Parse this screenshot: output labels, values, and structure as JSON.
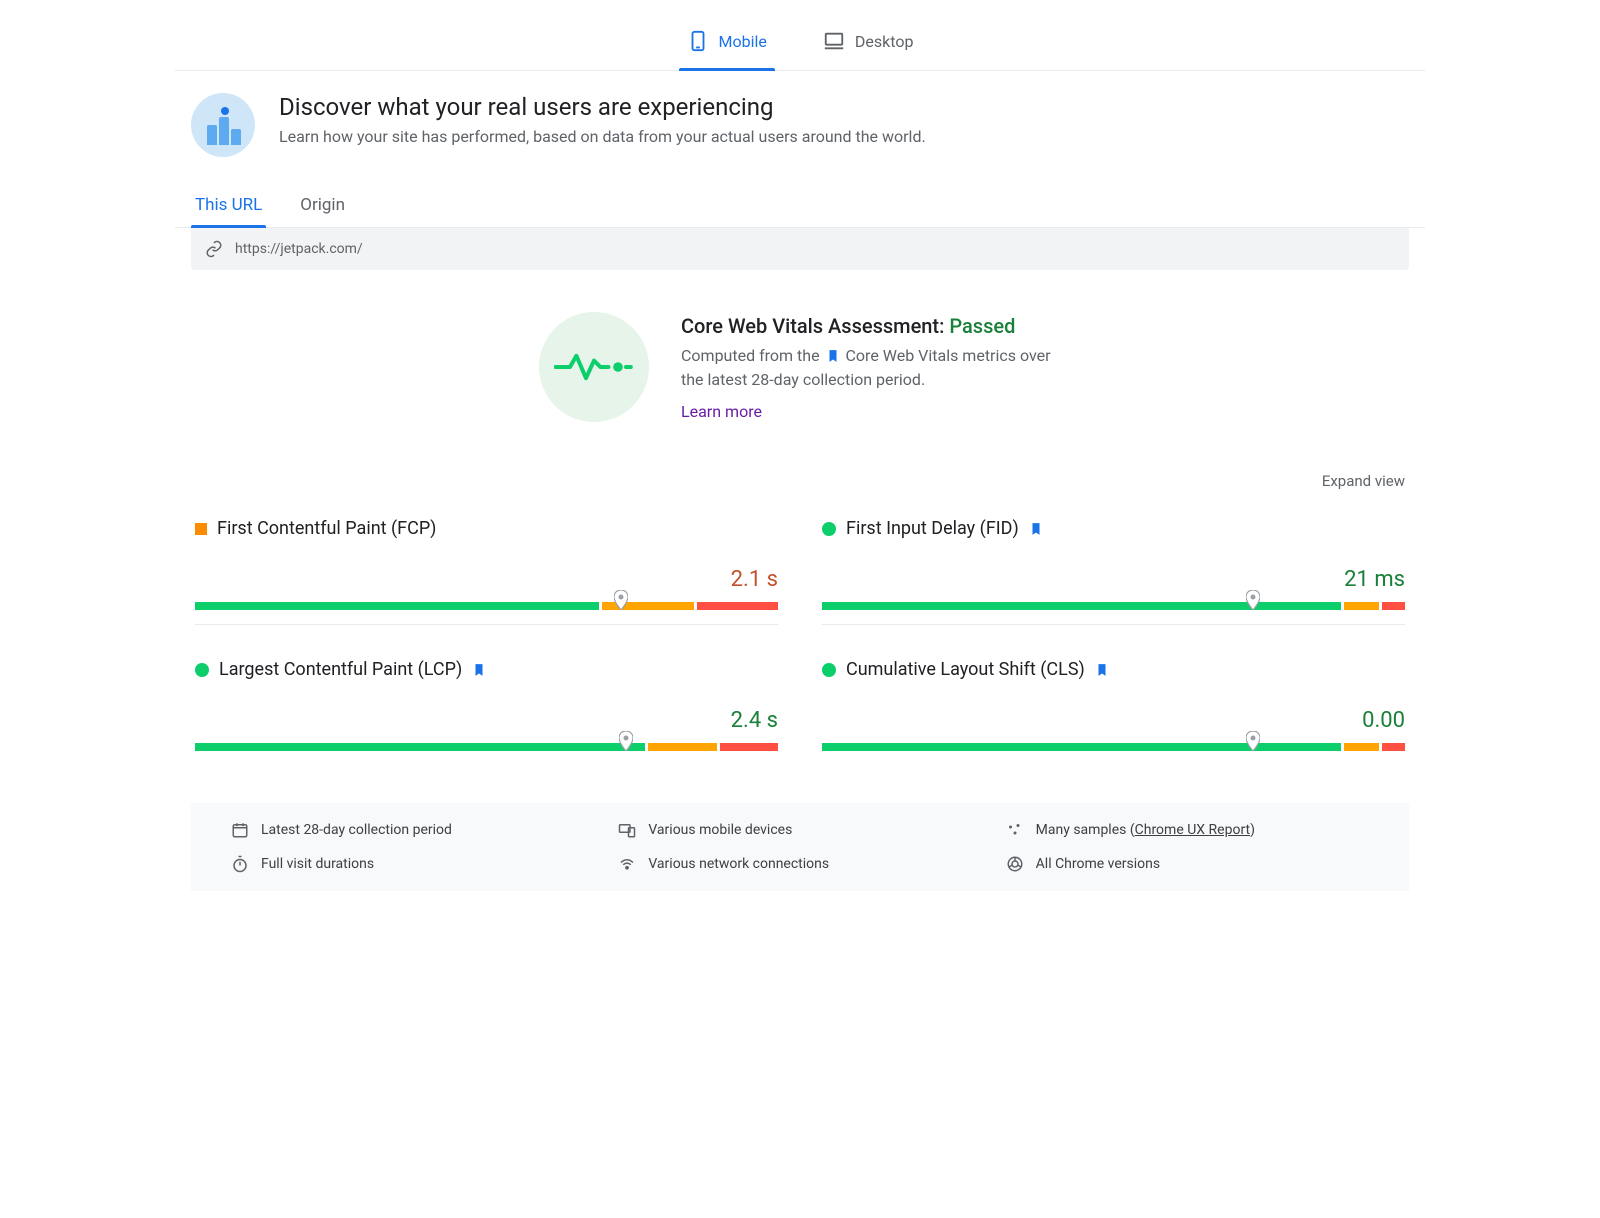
{
  "deviceTabs": {
    "mobile": "Mobile",
    "desktop": "Desktop",
    "active": "mobile"
  },
  "hero": {
    "title": "Discover what your real users are experiencing",
    "subtitle": "Learn how your site has performed, based on data from your actual users around the world."
  },
  "scopeTabs": {
    "thisUrl": "This URL",
    "origin": "Origin",
    "active": "thisUrl"
  },
  "url": "https://jetpack.com/",
  "assessment": {
    "titlePrefix": "Core Web Vitals Assessment: ",
    "status": "Passed",
    "descPart1": "Computed from the ",
    "descPart2": " Core Web Vitals metrics over the latest 28-day collection period.",
    "learnMore": "Learn more"
  },
  "expandView": "Expand view",
  "metrics": {
    "fcp": {
      "label": "First Contentful Paint (FCP)",
      "value": "2.1 s",
      "status": "orange",
      "markerPct": 73,
      "greenPct": 70,
      "orangePct": 16,
      "redPct": 14,
      "coreVital": false
    },
    "fid": {
      "label": "First Input Delay (FID)",
      "value": "21 ms",
      "status": "green",
      "markerPct": 74,
      "greenPct": 90,
      "orangePct": 6,
      "redPct": 4,
      "coreVital": true
    },
    "lcp": {
      "label": "Largest Contentful Paint (LCP)",
      "value": "2.4 s",
      "status": "green",
      "markerPct": 74,
      "greenPct": 78,
      "orangePct": 12,
      "redPct": 10,
      "coreVital": true
    },
    "cls": {
      "label": "Cumulative Layout Shift (CLS)",
      "value": "0.00",
      "status": "green",
      "markerPct": 74,
      "greenPct": 90,
      "orangePct": 6,
      "redPct": 4,
      "coreVital": true
    }
  },
  "footer": {
    "period": "Latest 28-day collection period",
    "devices": "Various mobile devices",
    "samplesPrefix": "Many samples (",
    "samplesLink": "Chrome UX Report",
    "samplesSuffix": ")",
    "durations": "Full visit durations",
    "network": "Various network connections",
    "versions": "All Chrome versions"
  }
}
